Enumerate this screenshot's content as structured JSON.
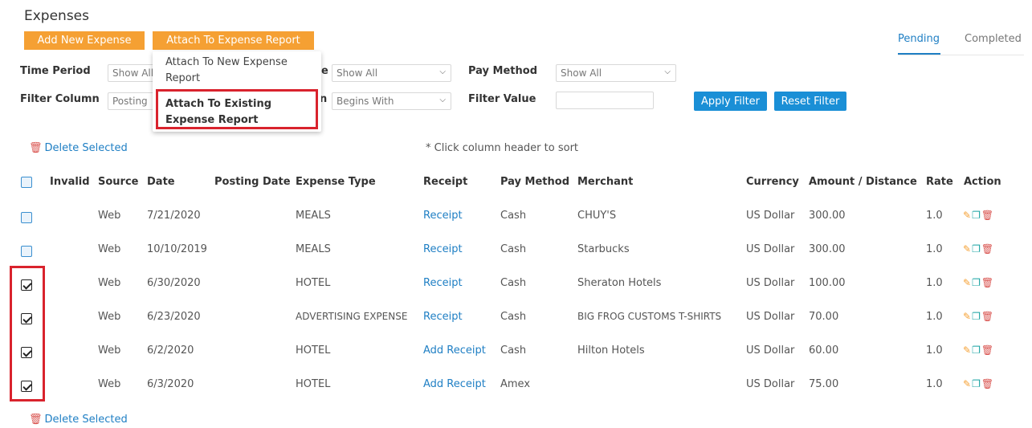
{
  "page": {
    "title": "Expenses"
  },
  "toolbar": {
    "add_label": "Add New Expense",
    "attach_label": "Attach To Expense Report"
  },
  "tabs": [
    {
      "label": "Pending",
      "active": true
    },
    {
      "label": "Completed",
      "active": false
    }
  ],
  "dropdown": {
    "items": [
      {
        "label": "Attach To New Expense Report"
      },
      {
        "label": "Attach To Existing Expense Report"
      }
    ]
  },
  "filters": {
    "time_period_label": "Time Period",
    "time_period_value": "Show All",
    "field2_partial_label": "e",
    "field2_value": "Show All",
    "pay_method_label": "Pay Method",
    "pay_method_value": "Show All",
    "filter_column_label": "Filter Column",
    "filter_column_value": "Posting",
    "field4_partial_label": "n",
    "field4_value": "Begins With",
    "filter_value_label": "Filter Value",
    "filter_value": "",
    "apply_label": "Apply Filter",
    "reset_label": "Reset Filter"
  },
  "table": {
    "delete_selected_label": "Delete Selected",
    "sort_note": "* Click column header to sort",
    "columns": [
      "Invalid",
      "Source",
      "Date",
      "Posting Date",
      "Expense Type",
      "Receipt",
      "Pay Method",
      "Merchant",
      "Currency",
      "Amount / Distance",
      "Rate",
      "Action"
    ],
    "rows": [
      {
        "checked": false,
        "invalid": "",
        "source": "Web",
        "date": "7/21/2020",
        "posting_date": "",
        "type": "MEALS",
        "receipt": "Receipt",
        "pay_method": "Cash",
        "merchant": "CHUY'S",
        "currency": "US Dollar",
        "amount": "300.00",
        "rate": "1.0"
      },
      {
        "checked": false,
        "invalid": "",
        "source": "Web",
        "date": "10/10/2019",
        "posting_date": "",
        "type": "MEALS",
        "receipt": "Receipt",
        "pay_method": "Cash",
        "merchant": "Starbucks",
        "currency": "US Dollar",
        "amount": "300.00",
        "rate": "1.0"
      },
      {
        "checked": true,
        "invalid": "",
        "source": "Web",
        "date": "6/30/2020",
        "posting_date": "",
        "type": "HOTEL",
        "receipt": "Receipt",
        "pay_method": "Cash",
        "merchant": "Sheraton Hotels",
        "currency": "US Dollar",
        "amount": "100.00",
        "rate": "1.0"
      },
      {
        "checked": true,
        "invalid": "",
        "source": "Web",
        "date": "6/23/2020",
        "posting_date": "",
        "type": "ADVERTISING EXPENSE",
        "receipt": "Receipt",
        "pay_method": "Cash",
        "merchant": "BIG FROG CUSTOMS T-SHIRTS",
        "currency": "US Dollar",
        "amount": "70.00",
        "rate": "1.0"
      },
      {
        "checked": true,
        "invalid": "",
        "source": "Web",
        "date": "6/2/2020",
        "posting_date": "",
        "type": "HOTEL",
        "receipt": "Add Receipt",
        "pay_method": "Cash",
        "merchant": "Hilton Hotels",
        "currency": "US Dollar",
        "amount": "60.00",
        "rate": "1.0"
      },
      {
        "checked": true,
        "invalid": "",
        "source": "Web",
        "date": "6/3/2020",
        "posting_date": "",
        "type": "HOTEL",
        "receipt": "Add Receipt",
        "pay_method": "Amex",
        "merchant": "",
        "currency": "US Dollar",
        "amount": "75.00",
        "rate": "1.0"
      }
    ]
  },
  "colors": {
    "accent_orange": "#f5a033",
    "link_blue": "#1f7fc4",
    "button_blue": "#1a8fd6",
    "highlight_red": "#d9232d"
  },
  "icons": [
    "trash-icon",
    "edit-icon",
    "copy-icon",
    "chevron-down-icon",
    "checkbox-icon"
  ]
}
